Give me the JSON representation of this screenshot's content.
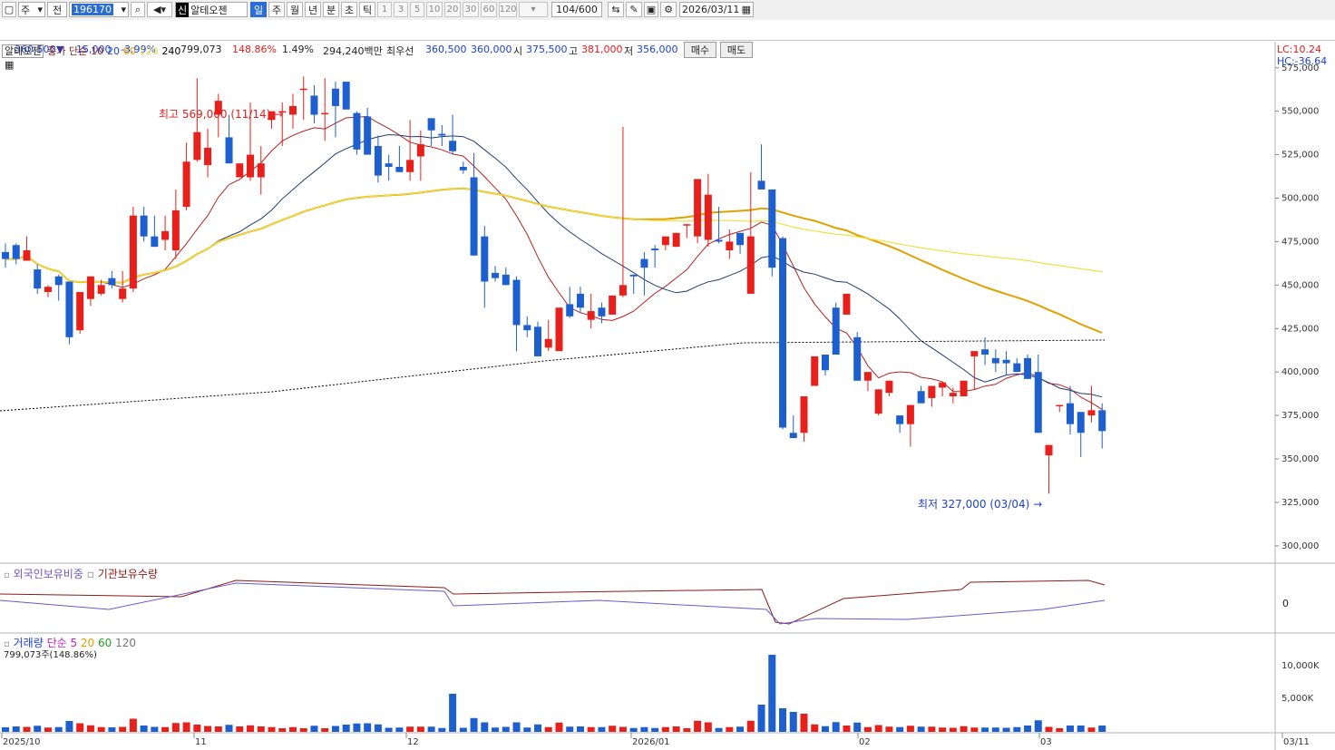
{
  "toolbar": {
    "market": "주",
    "type": "전",
    "code": "196170",
    "badge": "신",
    "name": "알테오젠",
    "periods": [
      "일",
      "주",
      "월",
      "년",
      "분",
      "초",
      "틱"
    ],
    "active_period": "일",
    "intervals": [
      "1",
      "3",
      "5",
      "10",
      "20",
      "30",
      "60",
      "120"
    ],
    "count": "104/600",
    "date": "2026/03/11"
  },
  "quote": {
    "price": "360,500",
    "change": "15,000",
    "rate": "-3.99%",
    "volume": "799,073",
    "vol_ratio": "148.86%",
    "turnover": "1.49%",
    "amount": "294,240백만",
    "bid_label": "최우선",
    "bid1": "360,500",
    "bid2": "360,000",
    "open_label": "시",
    "open": "375,500",
    "high_label": "고",
    "high": "381,000",
    "low_label": "저",
    "low": "356,000",
    "buy": "매수",
    "sell": "매도"
  },
  "price_panel": {
    "legend_name": "알테오젠",
    "legend_label": "종가 단순",
    "ma": [
      {
        "period": "10",
        "color": "#b22222"
      },
      {
        "period": "20",
        "color": "#1f3c6e"
      },
      {
        "period": "60",
        "color": "#e0a000"
      },
      {
        "period": "120",
        "color": "#f0e040"
      },
      {
        "period": "240",
        "color": "#000000"
      }
    ],
    "lc": "LC:10.24",
    "hc": "HC:-36.64",
    "max_label": "최고 569,000 (11/14)",
    "min_label": "최저 327,000 (03/04)",
    "up_color": "#e8201c",
    "down_color": "#1e5fd0"
  },
  "investor_panel": {
    "foreign": "외국인보유비중",
    "inst": "기관보유수량",
    "zero": "0"
  },
  "volume_panel": {
    "title": "거래량",
    "simple": "단순 5",
    "ma": [
      "20",
      "60",
      "120"
    ],
    "info": "799,073주(148.86%)"
  },
  "chart_data": {
    "type": "candlestick",
    "ylim": [
      290000,
      590000
    ],
    "y_ticks": [
      "575,000",
      "550,000",
      "525,000",
      "500,000",
      "475,000",
      "450,000",
      "425,000",
      "400,000",
      "375,000",
      "350,000",
      "325,000",
      "300,000"
    ],
    "vol_ticks": [
      "10,000K",
      "5,000K"
    ],
    "x_ticks": [
      "2025/10",
      "11",
      "12",
      "2026/01",
      "02",
      "03",
      "03/11"
    ],
    "candles": [
      [
        469,
        474,
        460,
        465
      ],
      [
        473,
        474,
        462,
        465
      ],
      [
        464,
        478,
        465,
        470
      ],
      [
        459,
        462,
        445,
        448
      ],
      [
        446,
        450,
        443,
        449
      ],
      [
        455,
        456,
        441,
        450
      ],
      [
        452,
        452,
        416,
        420
      ],
      [
        424,
        440,
        422,
        446
      ],
      [
        442,
        452,
        438,
        455
      ],
      [
        445,
        453,
        444,
        450
      ],
      [
        454,
        458,
        448,
        450
      ],
      [
        442,
        458,
        440,
        448
      ],
      [
        448,
        495,
        446,
        490
      ],
      [
        490,
        495,
        475,
        478
      ],
      [
        478,
        490,
        472,
        472
      ],
      [
        476,
        490,
        470,
        481
      ],
      [
        470,
        505,
        465,
        493
      ],
      [
        495,
        532,
        493,
        521
      ],
      [
        522,
        569,
        521,
        538
      ],
      [
        519,
        540,
        512,
        529
      ],
      [
        548,
        560,
        535,
        556
      ],
      [
        535,
        548,
        522,
        520
      ],
      [
        512,
        520,
        517,
        520
      ],
      [
        512,
        555,
        510,
        525
      ],
      [
        512,
        530,
        502,
        520
      ],
      [
        545,
        545,
        540,
        550
      ],
      [
        550,
        555,
        530,
        550
      ],
      [
        548,
        560,
        540,
        553
      ],
      [
        563,
        570,
        545,
        563
      ],
      [
        559,
        565,
        543,
        548
      ],
      [
        549,
        569,
        533,
        549
      ],
      [
        563,
        567,
        535,
        553
      ],
      [
        567,
        567,
        562,
        551
      ],
      [
        549,
        550,
        525,
        528
      ],
      [
        547,
        552,
        534,
        525
      ],
      [
        530,
        536,
        509,
        513
      ],
      [
        520,
        525,
        510,
        518
      ],
      [
        518,
        530,
        515,
        515
      ],
      [
        515,
        545,
        510,
        522
      ],
      [
        524,
        539,
        510,
        531
      ],
      [
        546,
        546,
        530,
        539
      ],
      [
        537,
        542,
        530,
        536
      ],
      [
        533,
        548,
        525,
        527
      ],
      [
        518,
        521,
        514,
        516
      ],
      [
        512,
        526,
        474,
        467
      ],
      [
        478,
        484,
        437,
        452
      ],
      [
        457,
        461,
        452,
        454
      ],
      [
        456,
        460,
        452,
        450
      ],
      [
        453,
        455,
        412,
        427
      ],
      [
        427,
        432,
        420,
        424
      ],
      [
        426,
        429,
        413,
        409
      ],
      [
        414,
        430,
        412,
        419
      ],
      [
        412,
        421,
        413,
        437
      ],
      [
        439,
        449,
        431,
        432
      ],
      [
        445,
        449,
        434,
        437
      ],
      [
        430,
        445,
        425,
        435
      ],
      [
        437,
        440,
        428,
        432
      ],
      [
        433,
        440,
        433,
        444
      ],
      [
        444,
        541,
        443,
        450
      ],
      [
        456,
        446,
        445,
        455
      ],
      [
        465,
        469,
        444,
        460
      ],
      [
        471,
        473,
        460,
        470
      ],
      [
        473,
        477,
        470,
        478
      ],
      [
        472,
        476,
        472,
        480
      ],
      [
        485,
        485,
        477,
        485
      ],
      [
        478,
        482,
        474,
        511
      ],
      [
        476,
        514,
        472,
        502
      ],
      [
        476,
        495,
        474,
        475
      ],
      [
        470,
        482,
        465,
        475
      ],
      [
        480,
        480,
        468,
        473
      ],
      [
        445,
        515,
        445,
        478
      ],
      [
        510,
        531,
        505,
        505
      ],
      [
        505,
        505,
        455,
        460
      ],
      [
        477,
        478,
        367,
        368
      ],
      [
        365,
        375,
        370,
        362
      ],
      [
        365,
        360,
        373,
        386
      ],
      [
        392,
        404,
        393,
        409
      ],
      [
        410,
        403,
        398,
        401
      ],
      [
        437,
        435,
        440,
        410
      ],
      [
        433,
        444,
        434,
        445
      ],
      [
        420,
        423,
        405,
        395
      ],
      [
        395,
        400,
        389,
        400
      ],
      [
        376,
        380,
        375,
        390
      ],
      [
        388,
        386,
        392,
        395
      ],
      [
        375,
        370,
        365,
        370
      ],
      [
        370,
        367,
        357,
        381
      ],
      [
        389,
        392,
        385,
        382
      ],
      [
        385,
        380,
        383,
        392
      ],
      [
        391,
        394,
        386,
        394
      ],
      [
        386,
        391,
        382,
        388
      ],
      [
        386,
        387,
        386,
        395
      ],
      [
        409,
        410,
        390,
        412
      ],
      [
        413,
        420,
        404,
        410
      ],
      [
        408,
        413,
        400,
        405
      ],
      [
        407,
        412,
        398,
        405
      ],
      [
        405,
        408,
        406,
        400
      ],
      [
        408,
        410,
        398,
        396
      ],
      [
        400,
        410,
        390,
        365
      ],
      [
        352,
        352,
        330,
        358
      ],
      [
        381,
        380,
        377,
        381
      ],
      [
        382,
        392,
        364,
        370
      ],
      [
        377,
        375,
        351,
        365
      ],
      [
        375,
        371,
        392,
        378
      ],
      [
        378,
        382,
        356,
        366
      ]
    ]
  }
}
